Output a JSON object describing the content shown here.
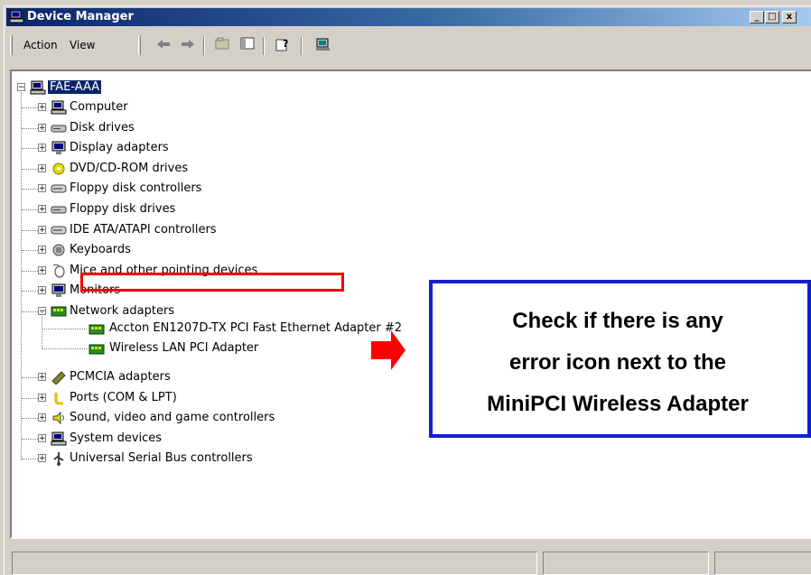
{
  "window": {
    "title": "Device Manager",
    "btn_min": "_",
    "btn_max": "□",
    "btn_close": "x"
  },
  "menu": {
    "action": "Action",
    "view": "View"
  },
  "tree": {
    "root": "FAE-AAA",
    "items": [
      "Computer",
      "Disk drives",
      "Display adapters",
      "DVD/CD-ROM drives",
      "Floppy disk controllers",
      "Floppy disk drives",
      "IDE ATA/ATAPI controllers",
      "Keyboards",
      "Mice and other pointing devices",
      "Monitors",
      "Network adapters",
      "PCMCIA adapters",
      "Ports (COM & LPT)",
      "Sound, video and game controllers",
      "System devices",
      "Universal Serial Bus controllers"
    ],
    "network_children": [
      "Accton EN1207D-TX PCI Fast Ethernet Adapter #2",
      "Wireless LAN PCI Adapter"
    ]
  },
  "callout": {
    "line1": "Check if there is any",
    "line2": "error icon next to the",
    "line3": "MiniPCI Wireless Adapter"
  },
  "colors": {
    "highlight_box": "#e00000",
    "arrow": "#ff0000",
    "callout_border": "#1020d0",
    "selection": "#0a246a"
  }
}
